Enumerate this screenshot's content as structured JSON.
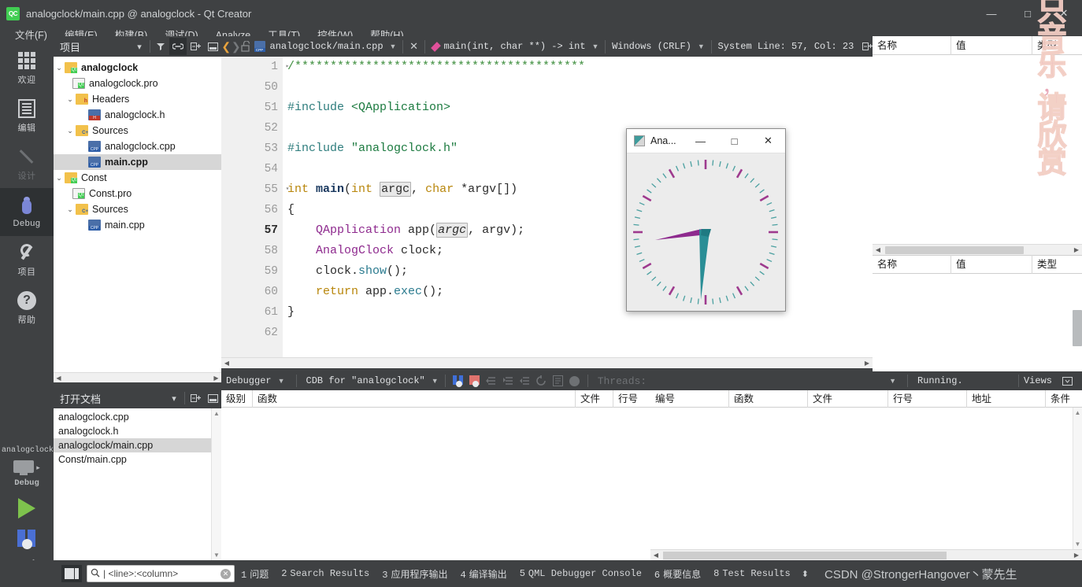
{
  "window": {
    "title": "analogclock/main.cpp @ analogclock - Qt Creator",
    "logo_text": "QC",
    "minimize": "—",
    "maximize": "□",
    "close": "✕"
  },
  "menubar": [
    {
      "label": "文件(F)"
    },
    {
      "label": "编辑(E)"
    },
    {
      "label": "构建(B)"
    },
    {
      "label": "调试(D)"
    },
    {
      "label": "Analyze"
    },
    {
      "label": "工具(T)"
    },
    {
      "label": "控件(W)"
    },
    {
      "label": "帮助(H)"
    }
  ],
  "modebar": {
    "items": [
      {
        "label": "欢迎",
        "icon": "grid-icon",
        "state": "normal"
      },
      {
        "label": "编辑",
        "icon": "document-icon",
        "state": "normal"
      },
      {
        "label": "设计",
        "icon": "pencil-icon",
        "state": "disabled"
      },
      {
        "label": "Debug",
        "icon": "bug-icon",
        "state": "active"
      },
      {
        "label": "项目",
        "icon": "wrench-icon",
        "state": "normal"
      },
      {
        "label": "帮助",
        "icon": "question-icon",
        "state": "normal"
      }
    ],
    "kit": {
      "project": "analogclock",
      "build_config": "Debug",
      "arrow": "▸"
    }
  },
  "project_panel": {
    "title": "项目",
    "buttons": [
      {
        "name": "filter-icon",
        "glyph": "▼"
      },
      {
        "name": "link-icon",
        "glyph": "⛓"
      },
      {
        "name": "split-icon",
        "glyph": "⊟"
      },
      {
        "name": "minimize-panel-icon",
        "glyph": "▭"
      }
    ],
    "tree": [
      {
        "label": "analogclock",
        "indent": 0,
        "chevron": "⌄",
        "icon": "qt-project-folder-icon",
        "bold": true,
        "selected": false
      },
      {
        "label": "analogclock.pro",
        "indent": 1,
        "chevron": "",
        "icon": "pro-file-icon",
        "bold": false,
        "selected": false
      },
      {
        "label": "Headers",
        "indent": 1,
        "chevron": "⌄",
        "icon": "headers-folder-icon",
        "bold": false,
        "selected": false
      },
      {
        "label": "analogclock.h",
        "indent": 2,
        "chevron": "",
        "icon": "header-file-icon",
        "bold": false,
        "selected": false
      },
      {
        "label": "Sources",
        "indent": 1,
        "chevron": "⌄",
        "icon": "sources-folder-icon",
        "bold": false,
        "selected": false
      },
      {
        "label": "analogclock.cpp",
        "indent": 2,
        "chevron": "",
        "icon": "cpp-file-icon",
        "bold": false,
        "selected": false
      },
      {
        "label": "main.cpp",
        "indent": 2,
        "chevron": "",
        "icon": "cpp-file-icon",
        "bold": false,
        "selected": true
      },
      {
        "label": "Const",
        "indent": 0,
        "chevron": "⌄",
        "icon": "qt-project-folder-icon",
        "bold": false,
        "selected": false
      },
      {
        "label": "Const.pro",
        "indent": 1,
        "chevron": "",
        "icon": "pro-file-icon",
        "bold": false,
        "selected": false
      },
      {
        "label": "Sources",
        "indent": 1,
        "chevron": "⌄",
        "icon": "sources-folder-icon",
        "bold": false,
        "selected": false
      },
      {
        "label": "main.cpp",
        "indent": 2,
        "chevron": "",
        "icon": "cpp-file-icon",
        "bold": false,
        "selected": false
      }
    ]
  },
  "docs_panel": {
    "title": "打开文档",
    "items": [
      {
        "label": "analogclock.cpp",
        "selected": false
      },
      {
        "label": "analogclock.h",
        "selected": false
      },
      {
        "label": "analogclock/main.cpp",
        "selected": true
      },
      {
        "label": "Const/main.cpp",
        "selected": false
      }
    ]
  },
  "editor_toolbar": {
    "back": "❮",
    "forward": "❯",
    "lock": "🔓",
    "filename": "analogclock/main.cpp",
    "close_label": "✕",
    "symbol": "main(int, char **) -> int",
    "line_ending": "Windows (CRLF)",
    "encoding_position": "System Line: 57, Col: 23",
    "split_label": "⊟"
  },
  "editor": {
    "lines": [
      {
        "num": "1",
        "fold": "▸",
        "current": false,
        "tokens": [
          {
            "t": "/*****************************************",
            "c": "cmt"
          }
        ]
      },
      {
        "num": "50",
        "fold": "",
        "current": false,
        "tokens": []
      },
      {
        "num": "51",
        "fold": "",
        "current": false,
        "tokens": [
          {
            "t": "#include ",
            "c": "prep"
          },
          {
            "t": "<QApplication>",
            "c": "str"
          }
        ]
      },
      {
        "num": "52",
        "fold": "",
        "current": false,
        "tokens": []
      },
      {
        "num": "53",
        "fold": "",
        "current": false,
        "tokens": [
          {
            "t": "#include ",
            "c": "prep"
          },
          {
            "t": "\"analogclock.h\"",
            "c": "str"
          }
        ]
      },
      {
        "num": "54",
        "fold": "",
        "current": false,
        "tokens": []
      },
      {
        "num": "55",
        "fold": "▾",
        "current": false,
        "tokens": [
          {
            "t": "int ",
            "c": "kw"
          },
          {
            "t": "main",
            "c": "fn"
          },
          {
            "t": "(",
            "c": "plain"
          },
          {
            "t": "int ",
            "c": "kw"
          },
          {
            "t": "argc",
            "c": "hl"
          },
          {
            "t": ", ",
            "c": "plain"
          },
          {
            "t": "char ",
            "c": "kw"
          },
          {
            "t": "*argv[])",
            "c": "plain"
          }
        ]
      },
      {
        "num": "56",
        "fold": "",
        "current": false,
        "tokens": [
          {
            "t": "{",
            "c": "plain"
          }
        ]
      },
      {
        "num": "57",
        "fold": "",
        "current": true,
        "tokens": [
          {
            "t": "    ",
            "c": "plain"
          },
          {
            "t": "QApplication",
            "c": "cls"
          },
          {
            "t": " app(",
            "c": "plain"
          },
          {
            "t": "argc",
            "c": "hli"
          },
          {
            "t": ", argv);",
            "c": "plain"
          }
        ]
      },
      {
        "num": "58",
        "fold": "",
        "current": false,
        "tokens": [
          {
            "t": "    ",
            "c": "plain"
          },
          {
            "t": "AnalogClock",
            "c": "cls"
          },
          {
            "t": " clock;",
            "c": "plain"
          }
        ]
      },
      {
        "num": "59",
        "fold": "",
        "current": false,
        "tokens": [
          {
            "t": "    clock.",
            "c": "plain"
          },
          {
            "t": "show",
            "c": "mth"
          },
          {
            "t": "();",
            "c": "plain"
          }
        ]
      },
      {
        "num": "60",
        "fold": "",
        "current": false,
        "tokens": [
          {
            "t": "    ",
            "c": "plain"
          },
          {
            "t": "return",
            "c": "kw"
          },
          {
            "t": " app.",
            "c": "plain"
          },
          {
            "t": "exec",
            "c": "mth"
          },
          {
            "t": "();",
            "c": "plain"
          }
        ]
      },
      {
        "num": "61",
        "fold": "",
        "current": false,
        "tokens": [
          {
            "t": "}",
            "c": "plain"
          }
        ]
      },
      {
        "num": "62",
        "fold": "",
        "current": false,
        "tokens": []
      }
    ]
  },
  "right_panel": {
    "locals": {
      "columns": [
        "名称",
        "值",
        "类型"
      ]
    },
    "watchers": {
      "columns": [
        "名称",
        "值",
        "类型"
      ]
    }
  },
  "debugger_toolbar": {
    "label": "Debugger",
    "config": "CDB for \"analogclock\"",
    "threads_label": "Threads:",
    "status": "Running.",
    "views_label": "Views",
    "buttons": [
      {
        "name": "continue-debug-icon"
      },
      {
        "name": "stop-debug-icon"
      },
      {
        "name": "step-over-icon"
      },
      {
        "name": "step-into-icon"
      },
      {
        "name": "step-out-icon"
      },
      {
        "name": "restart-icon"
      },
      {
        "name": "instruction-view-icon"
      },
      {
        "name": "interrupt-icon"
      }
    ]
  },
  "bottom_panels": {
    "stack": {
      "columns": [
        "级别",
        "函数",
        "文件",
        "行号"
      ],
      "rows": []
    },
    "breakpoints": {
      "columns": [
        "编号",
        "函数",
        "文件",
        "行号",
        "地址",
        "条件"
      ],
      "rows": []
    }
  },
  "statusbar": {
    "search_placeholder": "| <line>:<column>",
    "search_icon": "search-icon",
    "clear_icon": "✕",
    "tabs": [
      {
        "num": "1",
        "label": "问题"
      },
      {
        "num": "2",
        "label": "Search Results"
      },
      {
        "num": "3",
        "label": "应用程序输出"
      },
      {
        "num": "4",
        "label": "编译输出"
      },
      {
        "num": "5",
        "label": "QML Debugger Console"
      },
      {
        "num": "6",
        "label": "概要信息"
      },
      {
        "num": "8",
        "label": "Test Results"
      }
    ],
    "updown": "⬍",
    "credit": "CSDN @StrongerHangover丶蒙先生"
  },
  "clock_window": {
    "title": "Ana...",
    "minimize": "—",
    "maximize": "□",
    "close": "✕",
    "hour_hand_color": "#8e2a8e",
    "minute_hand_color": "#2a8e96",
    "hour_tick_color": "#9e3a8e",
    "minute_tick_color": "#4aa0a0",
    "face_color": "#ececec"
  },
  "watermark": {
    "chars": [
      "只",
      "音",
      "乐",
      "，",
      "请",
      "欣",
      "赏"
    ]
  }
}
